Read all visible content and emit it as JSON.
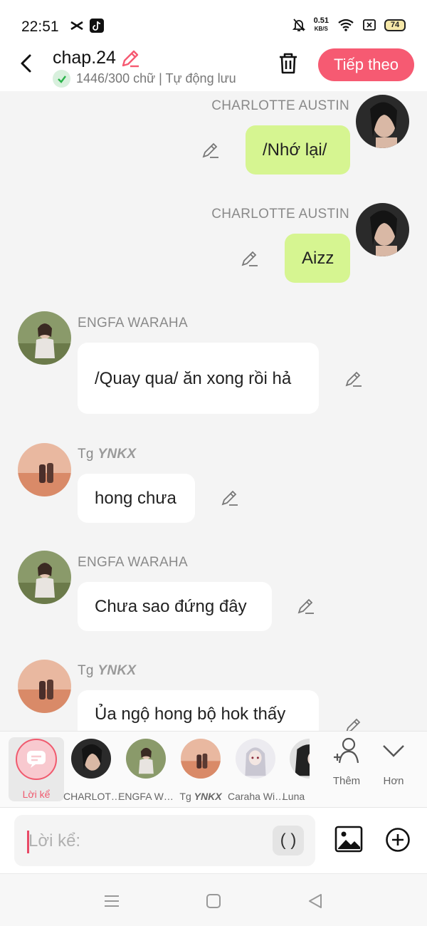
{
  "status_bar": {
    "time": "22:51",
    "net_speed_value": "0.51",
    "net_speed_unit": "KB/S",
    "battery": "74"
  },
  "header": {
    "title": "chap.24",
    "subtitle": "1446/300 chữ | Tự động lưu",
    "next_button": "Tiếp theo",
    "accent_color": "#f65a72"
  },
  "messages": [
    {
      "side": "right",
      "name": "CHARLOTTE AUSTIN",
      "text": "/Nhớ lại/",
      "bubble_color": "#d6f591"
    },
    {
      "side": "right",
      "name": "CHARLOTTE AUSTIN",
      "text": "Aizz",
      "bubble_color": "#d6f591"
    },
    {
      "side": "left",
      "name": "ENGFA WARAHA",
      "text": "/Quay qua/ ăn xong rồi hả",
      "bubble_color": "#ffffff"
    },
    {
      "side": "left",
      "name_prefix": "Tg",
      "name_bold": "YNKX",
      "text": "hong chưa",
      "bubble_color": "#ffffff"
    },
    {
      "side": "left",
      "name": "ENGFA WARAHA",
      "text": "Chưa sao đứng đây",
      "bubble_color": "#ffffff"
    },
    {
      "side": "left",
      "name_prefix": "Tg",
      "name_bold": "YNKX",
      "text": "Ủa ngộ hong bộ hok thấy",
      "bubble_color": "#ffffff"
    }
  ],
  "characters": [
    {
      "label": "Lời kể",
      "active": true
    },
    {
      "label": "CHARLOT…"
    },
    {
      "label": "ENGFA W…"
    },
    {
      "label_prefix": "Tg",
      "label_bold": "YNKX"
    },
    {
      "label": "Caraha Wi…"
    },
    {
      "label": "Luna"
    }
  ],
  "char_actions": {
    "add_label": "Thêm",
    "more_label": "Hơn"
  },
  "composer": {
    "placeholder": "Lời kể:",
    "paren_button": "( )"
  }
}
